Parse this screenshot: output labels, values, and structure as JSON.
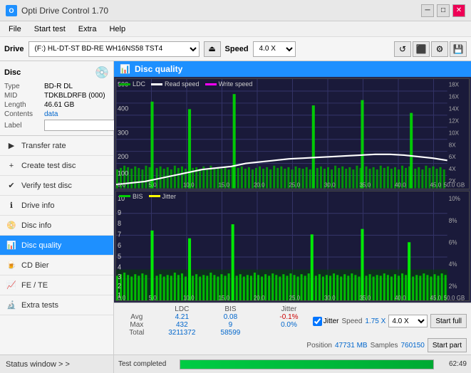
{
  "titleBar": {
    "appName": "Opti Drive Control 1.70",
    "minBtn": "─",
    "maxBtn": "□",
    "closeBtn": "✕"
  },
  "menuBar": {
    "items": [
      "File",
      "Start test",
      "Extra",
      "Help"
    ]
  },
  "driveBar": {
    "driveLabel": "Drive",
    "driveValue": "(F:)  HL-DT-ST BD-RE  WH16NS58 TST4",
    "speedLabel": "Speed",
    "speedValue": "4.0 X"
  },
  "sidebar": {
    "discTitle": "Disc",
    "discInfo": {
      "type": {
        "label": "Type",
        "value": "BD-R DL"
      },
      "mid": {
        "label": "MID",
        "value": "TDKBLDRFB (000)"
      },
      "length": {
        "label": "Length",
        "value": "46.61 GB"
      },
      "contents": {
        "label": "Contents",
        "value": "data"
      },
      "label": {
        "label": "Label",
        "value": ""
      }
    },
    "navItems": [
      {
        "id": "transfer-rate",
        "label": "Transfer rate",
        "icon": "▶"
      },
      {
        "id": "create-test-disc",
        "label": "Create test disc",
        "icon": "💿"
      },
      {
        "id": "verify-test-disc",
        "label": "Verify test disc",
        "icon": "✔"
      },
      {
        "id": "drive-info",
        "label": "Drive info",
        "icon": "ℹ"
      },
      {
        "id": "disc-info",
        "label": "Disc info",
        "icon": "📀"
      },
      {
        "id": "disc-quality",
        "label": "Disc quality",
        "icon": "📊",
        "active": true
      },
      {
        "id": "cd-bier",
        "label": "CD Bier",
        "icon": "🍺"
      },
      {
        "id": "fe-te",
        "label": "FE / TE",
        "icon": "📈"
      },
      {
        "id": "extra-tests",
        "label": "Extra tests",
        "icon": "🔬"
      }
    ],
    "statusWindow": "Status window > >"
  },
  "qualityHeader": {
    "title": "Disc quality"
  },
  "chart1": {
    "legend": [
      {
        "label": "LDC",
        "color": "#00aa00"
      },
      {
        "label": "Read speed",
        "color": "#ffffff"
      },
      {
        "label": "Write speed",
        "color": "#ff00ff"
      }
    ],
    "yLabels": [
      "18X",
      "16X",
      "14X",
      "12X",
      "10X",
      "8X",
      "6X",
      "4X",
      "2X"
    ]
  },
  "chart2": {
    "legend": [
      {
        "label": "BIS",
        "color": "#00cc00"
      },
      {
        "label": "Jitter",
        "color": "#ffff00"
      }
    ],
    "yLabels": [
      "10%",
      "8%",
      "6%",
      "4%",
      "2%"
    ]
  },
  "stats": {
    "columns": [
      "",
      "LDC",
      "BIS",
      "",
      "Jitter",
      "Speed",
      "",
      ""
    ],
    "avg": {
      "ldc": "4.21",
      "bis": "0.08",
      "jitter": "-0.1%"
    },
    "max": {
      "ldc": "432",
      "bis": "9",
      "jitter": "0.0%"
    },
    "total": {
      "ldc": "3211372",
      "bis": "58599"
    },
    "speedVal": "1.75 X",
    "speedSelect": "4.0 X",
    "position": "47731 MB",
    "samples": "760150",
    "startFull": "Start full",
    "startPart": "Start part"
  },
  "progressBar": {
    "statusText": "Test completed",
    "progressPct": 100,
    "timeText": "62:49"
  }
}
